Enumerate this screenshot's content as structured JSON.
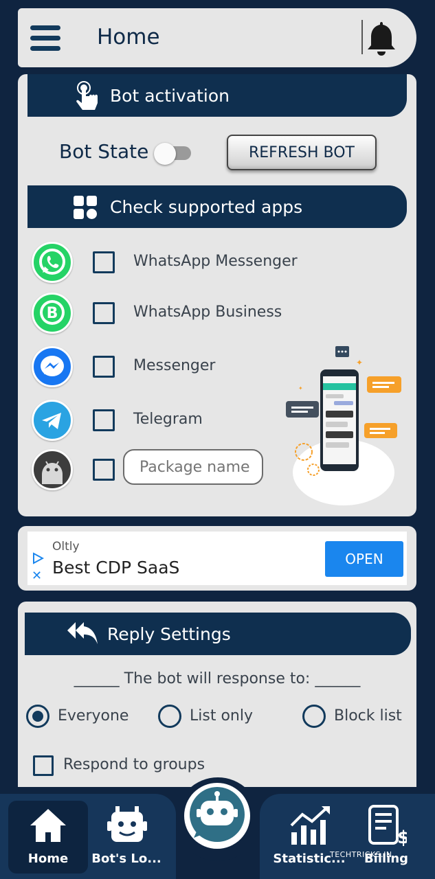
{
  "header": {
    "title": "Home"
  },
  "bot_activation": {
    "title": "Bot activation",
    "state_label": "Bot State",
    "toggle_on": false,
    "refresh_label": "REFRESH BOT"
  },
  "supported_apps": {
    "title": "Check supported apps",
    "items": [
      {
        "label": "WhatsApp Messenger",
        "icon": "whatsapp-icon",
        "checked": false
      },
      {
        "label": "WhatsApp Business",
        "icon": "whatsapp-business-icon",
        "checked": false
      },
      {
        "label": "Messenger",
        "icon": "messenger-icon",
        "checked": false
      },
      {
        "label": "Telegram",
        "icon": "telegram-icon",
        "checked": false
      }
    ],
    "package_placeholder": "Package name"
  },
  "ad": {
    "advertiser": "Oltly",
    "title": "Best CDP SaaS",
    "cta": "OPEN"
  },
  "reply_settings": {
    "title": "Reply Settings",
    "caption": "______ The bot will response to: ______",
    "options": [
      "Everyone",
      "List only",
      "Block list"
    ],
    "selected": "Everyone",
    "groups_label": "Respond to groups"
  },
  "nav": {
    "home": "Home",
    "bots_log": "Bot's Lo...",
    "statistics": "Statistic...",
    "billing": "Billing"
  },
  "watermark": "TECHTRICKS.IN",
  "colors": {
    "background": "#0f2440",
    "card": "#e6e6e6",
    "section_bar": "#0f2f4f",
    "accent_blue": "#1a86ee",
    "whatsapp_green": "#25d366"
  }
}
